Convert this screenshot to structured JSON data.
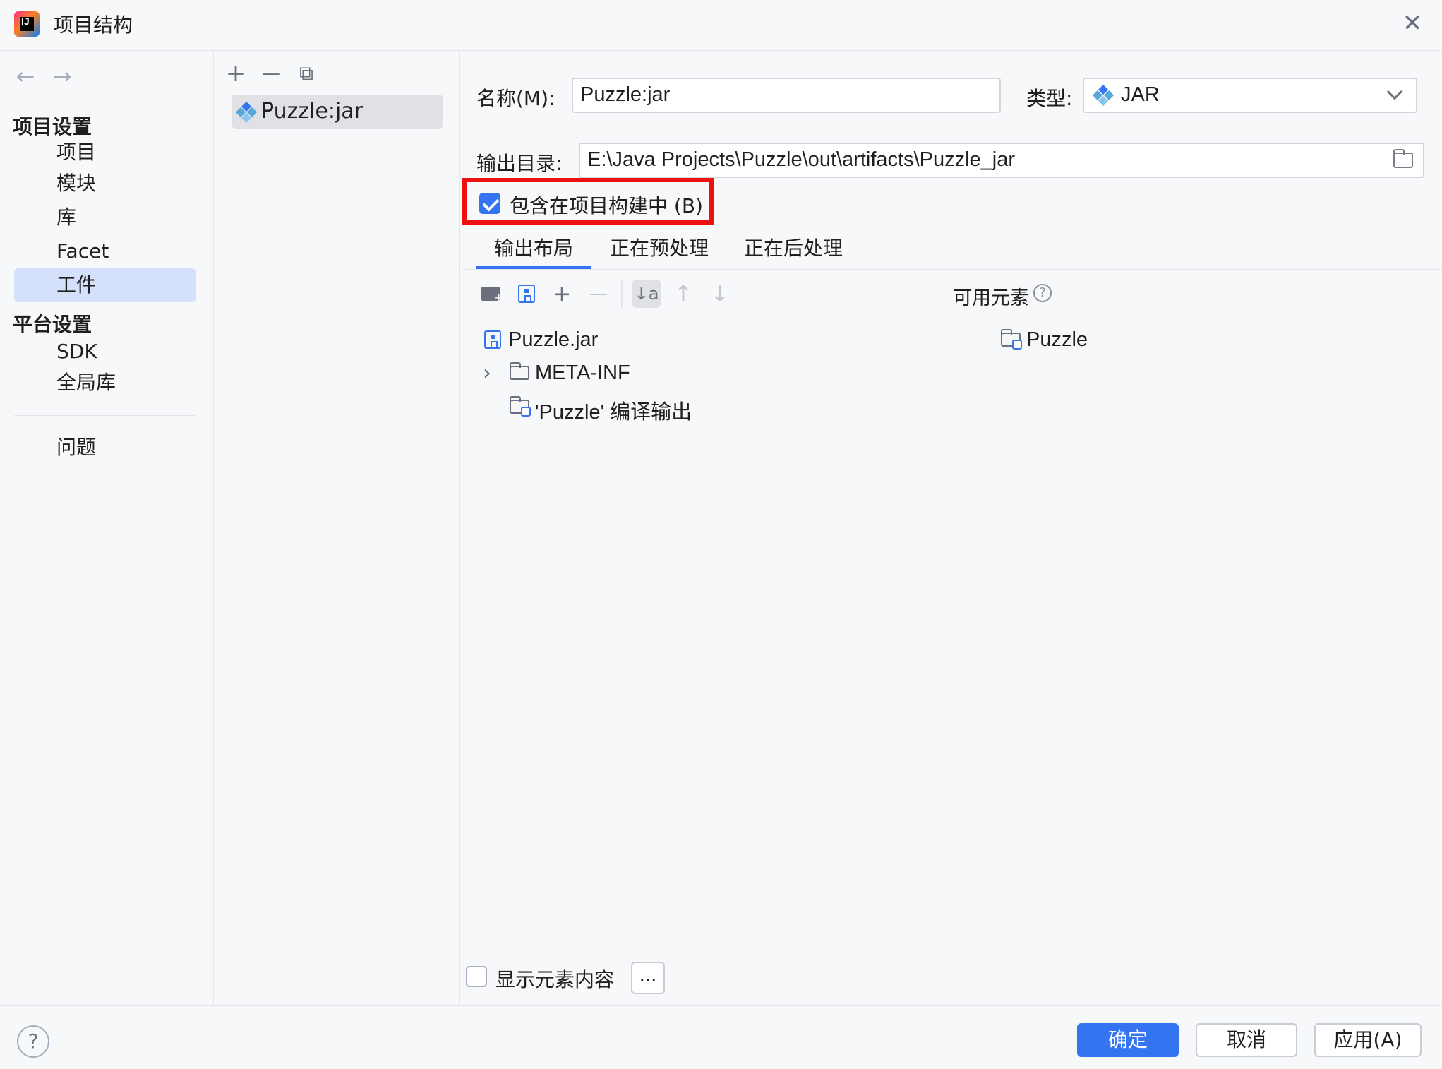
{
  "window": {
    "title": "项目结构",
    "close_glyph": "✕",
    "app_icon_text": "IJ"
  },
  "nav": {
    "back_glyph": "←",
    "forward_glyph": "→"
  },
  "sidebar": {
    "project_settings_header": "项目设置",
    "project_items": [
      "项目",
      "模块",
      "库",
      "Facet",
      "工件"
    ],
    "selected_item": "工件",
    "platform_settings_header": "平台设置",
    "platform_items": [
      "SDK",
      "全局库"
    ],
    "problems": "问题"
  },
  "artifact_list": {
    "toolbar": {
      "add_glyph": "+",
      "remove_glyph": "—",
      "copy_glyph": "⧉"
    },
    "items": [
      "Puzzle:jar"
    ]
  },
  "form": {
    "name_label": "名称(M):",
    "name_value": "Puzzle:jar",
    "type_label": "类型:",
    "type_value": "JAR",
    "output_dir_label": "输出目录:",
    "output_dir_value": "E:\\Java Projects\\Puzzle\\out\\artifacts\\Puzzle_jar",
    "include_in_build_label": "包含在项目构建中 (B)",
    "include_in_build_checked": true
  },
  "tabs": [
    "输出布局",
    "正在预处理",
    "正在后处理"
  ],
  "active_tab": "输出布局",
  "layout_toolbar": {
    "add_plus_glyph": "+",
    "remove_glyph": "—",
    "sort_glyph": "↓a",
    "move_up_glyph": "↑",
    "move_down_glyph": "↓"
  },
  "output_tree": {
    "root": "Puzzle.jar",
    "children": [
      "META-INF",
      "'Puzzle' 编译输出"
    ]
  },
  "available": {
    "header": "可用元素",
    "help_glyph": "?",
    "items": [
      "Puzzle"
    ]
  },
  "show_contents": {
    "label": "显示元素内容",
    "checked": false,
    "more_label": "..."
  },
  "footer": {
    "help_glyph": "?",
    "ok": "确定",
    "cancel": "取消",
    "apply": "应用(A)"
  },
  "colors": {
    "accent": "#3574f0",
    "highlight": "#ee1111",
    "selected_bg": "#d5e1fb"
  }
}
